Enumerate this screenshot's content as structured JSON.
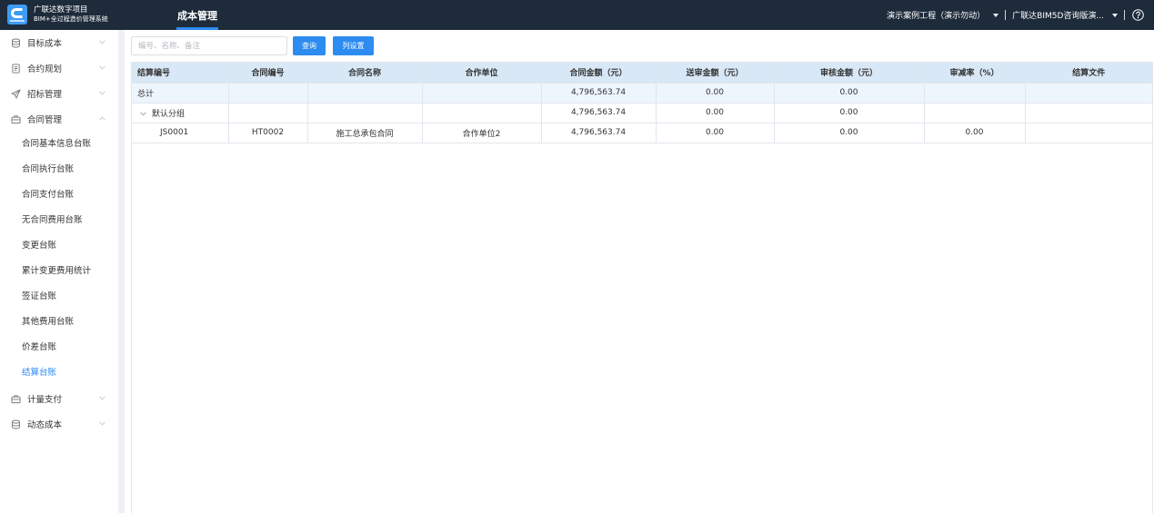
{
  "theme": {
    "accent": "#2d8cf0",
    "header_background": "#1d2b3b",
    "table_header_background": "#d9e8f7",
    "total_row_background": "#edf5fd"
  },
  "header": {
    "logo_icon": "glodon-logo-icon",
    "brand_line1": "广联达数字项目",
    "brand_line2": "BIM+全过程造价管理系统",
    "nav_tab": "成本管理",
    "project_select": "演示案例工程（演示勿动）",
    "org_select": "广联达BIM5D咨询版演...",
    "help_icon": "help-circle-icon"
  },
  "sidebar": {
    "items": [
      {
        "label": "目标成本",
        "icon": "database-icon",
        "expanded": false
      },
      {
        "label": "合约规划",
        "icon": "document-icon",
        "expanded": false
      },
      {
        "label": "招标管理",
        "icon": "send-icon",
        "expanded": false
      },
      {
        "label": "合同管理",
        "icon": "briefcase-icon",
        "expanded": true,
        "children": [
          {
            "label": "合同基本信息台账"
          },
          {
            "label": "合同执行台账"
          },
          {
            "label": "合同支付台账"
          },
          {
            "label": "无合同费用台账"
          },
          {
            "label": "变更台账"
          },
          {
            "label": "累计变更费用统计"
          },
          {
            "label": "签证台账"
          },
          {
            "label": "其他费用台账"
          },
          {
            "label": "价差台账"
          },
          {
            "label": "结算台账",
            "active": true
          }
        ]
      },
      {
        "label": "计量支付",
        "icon": "briefcase-icon",
        "expanded": false
      },
      {
        "label": "动态成本",
        "icon": "database-icon",
        "expanded": false
      }
    ]
  },
  "toolbar": {
    "search_value": "",
    "search_placeholder": "编号、名称、备注",
    "query_label": "查询",
    "column_settings_label": "列设置"
  },
  "table": {
    "columns": [
      "结算编号",
      "合同编号",
      "合同名称",
      "合作单位",
      "合同金额（元）",
      "送审金额（元）",
      "审核金额（元）",
      "审减率（%）",
      "结算文件"
    ],
    "total_row": {
      "label": "总计",
      "contract_amount": "4,796,563.74",
      "submitted_amount": "0.00",
      "audited_amount": "0.00"
    },
    "group_row": {
      "label": "默认分组",
      "expanded": true,
      "contract_amount": "4,796,563.74",
      "submitted_amount": "0.00",
      "audited_amount": "0.00"
    },
    "rows": [
      {
        "settlement_no": "JS0001",
        "contract_no": "HT0002",
        "contract_name": "施工总承包合同",
        "partner": "合作单位2",
        "contract_amount": "4,796,563.74",
        "submitted_amount": "0.00",
        "audited_amount": "0.00",
        "reduction_rate": "0.00"
      }
    ]
  }
}
